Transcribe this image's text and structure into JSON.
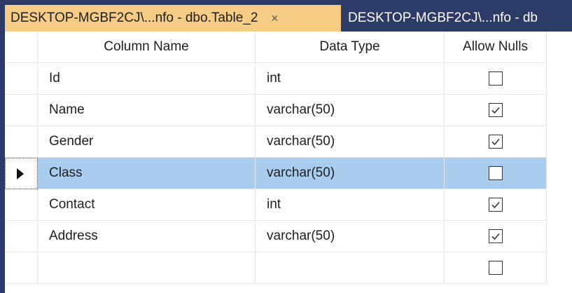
{
  "tabs": [
    {
      "title": "DESKTOP-MGBF2CJ\\...nfo - dbo.Table_2",
      "close": "×",
      "active": true
    },
    {
      "title": "DESKTOP-MGBF2CJ\\...nfo - db",
      "active": false
    }
  ],
  "columns": {
    "name": "Column Name",
    "type": "Data Type",
    "nulls": "Allow Nulls"
  },
  "rows": [
    {
      "name": "Id",
      "type": "int",
      "allow_nulls": false,
      "selected": false
    },
    {
      "name": "Name",
      "type": "varchar(50)",
      "allow_nulls": true,
      "selected": false
    },
    {
      "name": "Gender",
      "type": "varchar(50)",
      "allow_nulls": true,
      "selected": false
    },
    {
      "name": "Class",
      "type": "varchar(50)",
      "allow_nulls": false,
      "selected": true
    },
    {
      "name": "Contact",
      "type": "int",
      "allow_nulls": true,
      "selected": false
    },
    {
      "name": "Address",
      "type": "varchar(50)",
      "allow_nulls": true,
      "selected": false
    },
    {
      "name": "",
      "type": "",
      "allow_nulls": false,
      "selected": false
    }
  ],
  "colors": {
    "tab_strip": "#2b3a67",
    "active_tab": "#f5cc84",
    "selected_row": "#a9cdef"
  },
  "icons": {
    "row_indicator": "triangle-right-icon",
    "close": "close-icon",
    "checked": "checkmark-icon"
  }
}
